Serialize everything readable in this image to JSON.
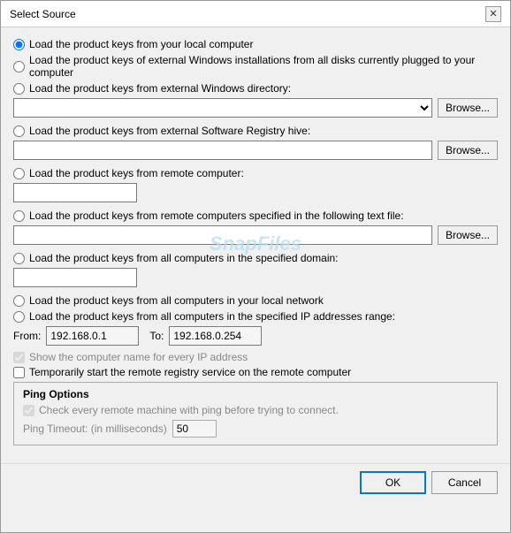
{
  "dialog": {
    "title": "Select Source",
    "close_label": "✕"
  },
  "options": [
    {
      "id": "opt1",
      "label": "Load the product keys from your local computer",
      "checked": true
    },
    {
      "id": "opt2",
      "label": "Load the product keys of external Windows installations from all disks currently plugged to your computer",
      "checked": false
    },
    {
      "id": "opt3",
      "label": "Load the product keys from external Windows directory:",
      "checked": false
    },
    {
      "id": "opt4",
      "label": "Load the product keys from external Software Registry hive:",
      "checked": false
    },
    {
      "id": "opt5",
      "label": "Load the product keys from remote computer:",
      "checked": false
    },
    {
      "id": "opt6",
      "label": "Load the product keys from remote computers specified in the following text file:",
      "checked": false
    },
    {
      "id": "opt7",
      "label": "Load the product keys from all computers in the specified domain:",
      "checked": false
    },
    {
      "id": "opt8",
      "label": "Load the product keys from all computers in your local network",
      "checked": false
    },
    {
      "id": "opt9",
      "label": "Load the product keys from all computers in the specified IP addresses range:",
      "checked": false
    }
  ],
  "inputs": {
    "directory_placeholder": "",
    "registry_placeholder": "",
    "remote_computer_placeholder": "",
    "text_file_placeholder": "",
    "domain_placeholder": "",
    "from_value": "192.168.0.1",
    "to_value": "192.168.0.254"
  },
  "labels": {
    "from": "From:",
    "to": "To:",
    "browse": "Browse..."
  },
  "checkboxes": {
    "show_computer_name": {
      "label": "Show the computer name for every IP address",
      "checked": true,
      "disabled": true
    },
    "temp_start": {
      "label": "Temporarily start the remote registry service on the remote computer",
      "checked": false,
      "disabled": false
    }
  },
  "ping_section": {
    "title": "Ping Options",
    "check_label": "Check every remote machine with ping before trying to connect.",
    "checked": true,
    "disabled": true,
    "timeout_label": "Ping Timeout: (in milliseconds)",
    "timeout_value": "50"
  },
  "footer": {
    "ok_label": "OK",
    "cancel_label": "Cancel"
  },
  "watermark": "SnapFiles"
}
